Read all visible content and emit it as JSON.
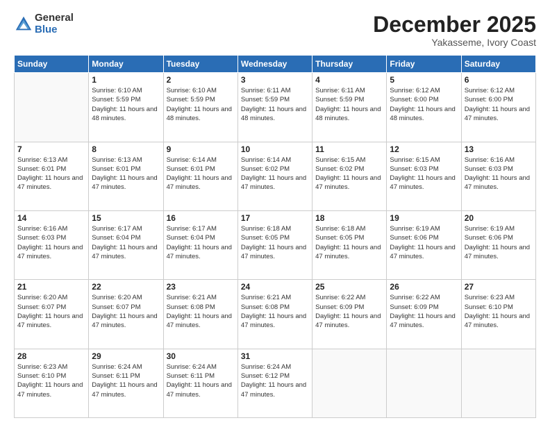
{
  "header": {
    "logo_general": "General",
    "logo_blue": "Blue",
    "month_title": "December 2025",
    "location": "Yakasseme, Ivory Coast"
  },
  "days_of_week": [
    "Sunday",
    "Monday",
    "Tuesday",
    "Wednesday",
    "Thursday",
    "Friday",
    "Saturday"
  ],
  "weeks": [
    [
      {
        "day": "",
        "sunrise": "",
        "sunset": "",
        "daylight": "",
        "empty": true
      },
      {
        "day": "1",
        "sunrise": "6:10 AM",
        "sunset": "5:59 PM",
        "daylight": "11 hours and 48 minutes."
      },
      {
        "day": "2",
        "sunrise": "6:10 AM",
        "sunset": "5:59 PM",
        "daylight": "11 hours and 48 minutes."
      },
      {
        "day": "3",
        "sunrise": "6:11 AM",
        "sunset": "5:59 PM",
        "daylight": "11 hours and 48 minutes."
      },
      {
        "day": "4",
        "sunrise": "6:11 AM",
        "sunset": "5:59 PM",
        "daylight": "11 hours and 48 minutes."
      },
      {
        "day": "5",
        "sunrise": "6:12 AM",
        "sunset": "6:00 PM",
        "daylight": "11 hours and 48 minutes."
      },
      {
        "day": "6",
        "sunrise": "6:12 AM",
        "sunset": "6:00 PM",
        "daylight": "11 hours and 47 minutes."
      }
    ],
    [
      {
        "day": "7",
        "sunrise": "6:13 AM",
        "sunset": "6:01 PM",
        "daylight": "11 hours and 47 minutes."
      },
      {
        "day": "8",
        "sunrise": "6:13 AM",
        "sunset": "6:01 PM",
        "daylight": "11 hours and 47 minutes."
      },
      {
        "day": "9",
        "sunrise": "6:14 AM",
        "sunset": "6:01 PM",
        "daylight": "11 hours and 47 minutes."
      },
      {
        "day": "10",
        "sunrise": "6:14 AM",
        "sunset": "6:02 PM",
        "daylight": "11 hours and 47 minutes."
      },
      {
        "day": "11",
        "sunrise": "6:15 AM",
        "sunset": "6:02 PM",
        "daylight": "11 hours and 47 minutes."
      },
      {
        "day": "12",
        "sunrise": "6:15 AM",
        "sunset": "6:03 PM",
        "daylight": "11 hours and 47 minutes."
      },
      {
        "day": "13",
        "sunrise": "6:16 AM",
        "sunset": "6:03 PM",
        "daylight": "11 hours and 47 minutes."
      }
    ],
    [
      {
        "day": "14",
        "sunrise": "6:16 AM",
        "sunset": "6:03 PM",
        "daylight": "11 hours and 47 minutes."
      },
      {
        "day": "15",
        "sunrise": "6:17 AM",
        "sunset": "6:04 PM",
        "daylight": "11 hours and 47 minutes."
      },
      {
        "day": "16",
        "sunrise": "6:17 AM",
        "sunset": "6:04 PM",
        "daylight": "11 hours and 47 minutes."
      },
      {
        "day": "17",
        "sunrise": "6:18 AM",
        "sunset": "6:05 PM",
        "daylight": "11 hours and 47 minutes."
      },
      {
        "day": "18",
        "sunrise": "6:18 AM",
        "sunset": "6:05 PM",
        "daylight": "11 hours and 47 minutes."
      },
      {
        "day": "19",
        "sunrise": "6:19 AM",
        "sunset": "6:06 PM",
        "daylight": "11 hours and 47 minutes."
      },
      {
        "day": "20",
        "sunrise": "6:19 AM",
        "sunset": "6:06 PM",
        "daylight": "11 hours and 47 minutes."
      }
    ],
    [
      {
        "day": "21",
        "sunrise": "6:20 AM",
        "sunset": "6:07 PM",
        "daylight": "11 hours and 47 minutes."
      },
      {
        "day": "22",
        "sunrise": "6:20 AM",
        "sunset": "6:07 PM",
        "daylight": "11 hours and 47 minutes."
      },
      {
        "day": "23",
        "sunrise": "6:21 AM",
        "sunset": "6:08 PM",
        "daylight": "11 hours and 47 minutes."
      },
      {
        "day": "24",
        "sunrise": "6:21 AM",
        "sunset": "6:08 PM",
        "daylight": "11 hours and 47 minutes."
      },
      {
        "day": "25",
        "sunrise": "6:22 AM",
        "sunset": "6:09 PM",
        "daylight": "11 hours and 47 minutes."
      },
      {
        "day": "26",
        "sunrise": "6:22 AM",
        "sunset": "6:09 PM",
        "daylight": "11 hours and 47 minutes."
      },
      {
        "day": "27",
        "sunrise": "6:23 AM",
        "sunset": "6:10 PM",
        "daylight": "11 hours and 47 minutes."
      }
    ],
    [
      {
        "day": "28",
        "sunrise": "6:23 AM",
        "sunset": "6:10 PM",
        "daylight": "11 hours and 47 minutes."
      },
      {
        "day": "29",
        "sunrise": "6:24 AM",
        "sunset": "6:11 PM",
        "daylight": "11 hours and 47 minutes."
      },
      {
        "day": "30",
        "sunrise": "6:24 AM",
        "sunset": "6:11 PM",
        "daylight": "11 hours and 47 minutes."
      },
      {
        "day": "31",
        "sunrise": "6:24 AM",
        "sunset": "6:12 PM",
        "daylight": "11 hours and 47 minutes."
      },
      {
        "day": "",
        "sunrise": "",
        "sunset": "",
        "daylight": "",
        "empty": true
      },
      {
        "day": "",
        "sunrise": "",
        "sunset": "",
        "daylight": "",
        "empty": true
      },
      {
        "day": "",
        "sunrise": "",
        "sunset": "",
        "daylight": "",
        "empty": true
      }
    ]
  ],
  "cell_labels": {
    "sunrise": "Sunrise:",
    "sunset": "Sunset:",
    "daylight": "Daylight:"
  }
}
